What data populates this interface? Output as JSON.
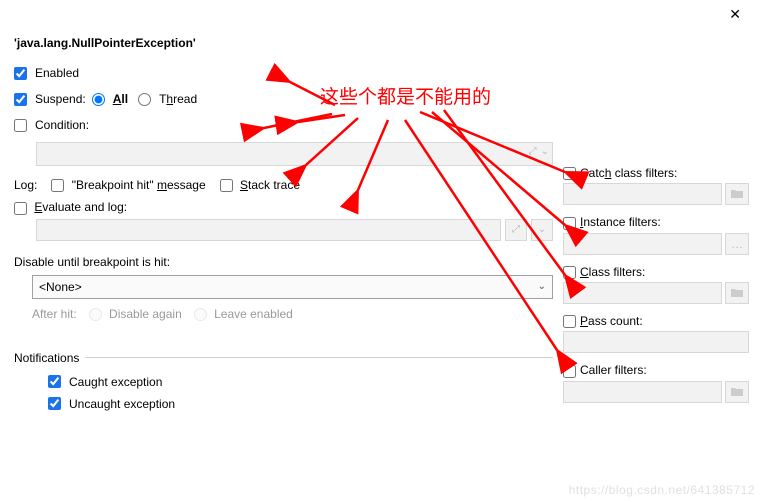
{
  "window": {
    "title": "'java.lang.NullPointerException'"
  },
  "enabled": {
    "label": "Enabled",
    "checked": true
  },
  "suspend": {
    "label": "Suspend:",
    "checked": true,
    "all_label": "All",
    "thread_label": "Thread",
    "selected": "all"
  },
  "condition": {
    "label": "Condition:",
    "checked": false
  },
  "log": {
    "label": "Log:",
    "bp_hit_label": "\"Breakpoint hit\" message",
    "bp_hit_underline": "m",
    "stack_label": "Stack trace",
    "stack_underline": "S"
  },
  "evaluate": {
    "label": "Evaluate and log:",
    "underline": "E",
    "checked": false
  },
  "disable_until": {
    "label": "Disable until breakpoint is hit:",
    "select_value": "<None>",
    "after_hit_label": "After hit:",
    "disable_again_label": "Disable again",
    "leave_enabled_label": "Leave enabled"
  },
  "right": {
    "catch_class": {
      "label": "Catch class filters:",
      "underline": "h"
    },
    "instance": {
      "label": "Instance filters:",
      "underline": "I"
    },
    "class": {
      "label": "Class filters:",
      "underline": "C"
    },
    "pass_count": {
      "label": "Pass count:",
      "underline": "P"
    },
    "caller": {
      "label": "Caller filters:"
    }
  },
  "notifications": {
    "heading": "Notifications",
    "caught": {
      "label": "Caught exception",
      "checked": true
    },
    "uncaught": {
      "label": "Uncaught exception",
      "checked": true
    }
  },
  "annotation": {
    "text": "这些个都是不能用的"
  },
  "watermark": "https://blog.csdn.net/641385712"
}
